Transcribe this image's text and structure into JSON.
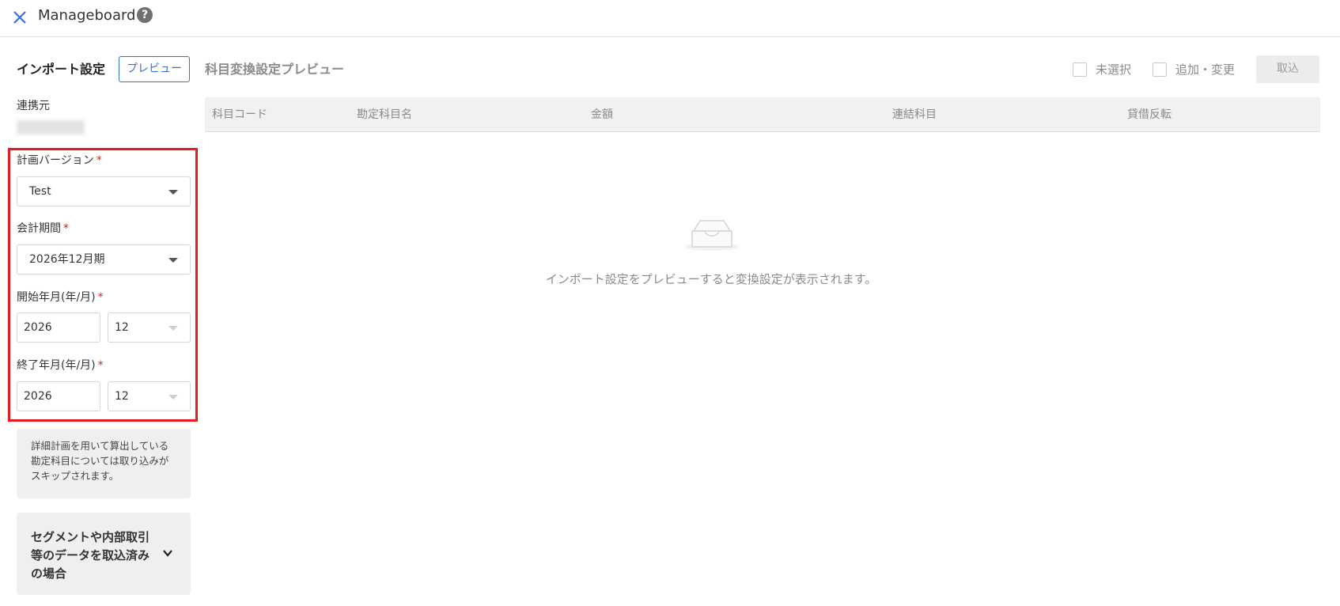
{
  "header": {
    "title": "Manageboard",
    "help": "?"
  },
  "left_panel": {
    "heading": "インポート設定",
    "preview_button": "プレビュー",
    "source_label": "連携元",
    "fields": {
      "plan_version": {
        "label": "計画バージョン",
        "required_mark": "*",
        "value": "Test"
      },
      "fiscal_period": {
        "label": "会計期間",
        "required_mark": "*",
        "value": "2026年12月期"
      },
      "start_ym": {
        "label": "開始年月(年/月)",
        "required_mark": "*",
        "year": "2026",
        "month": "12"
      },
      "end_ym": {
        "label": "終了年月(年/月)",
        "required_mark": "*",
        "year": "2026",
        "month": "12"
      }
    },
    "info_text": "詳細計画を用いて算出している勘定科目については取り込みがスキップされます。",
    "accordion_label": "セグメントや内部取引等のデータを取込済みの場合"
  },
  "preview": {
    "heading": "科目変換設定プレビュー",
    "filters": {
      "unselected": "未選択",
      "add_change": "追加・変更"
    },
    "import_button": "取込",
    "columns": [
      "科目コード",
      "勘定科目名",
      "金額",
      "連結科目",
      "貸借反転"
    ],
    "empty_message": "インポート設定をプレビューすると変換設定が表示されます。"
  },
  "colors": {
    "accent": "#3a6fd8",
    "highlight": "#e8191f",
    "required": "#e8191f"
  }
}
